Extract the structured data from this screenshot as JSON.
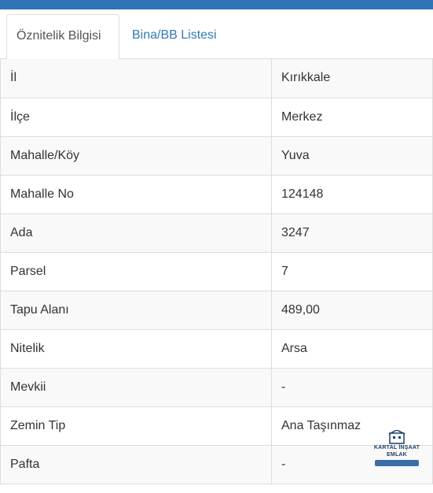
{
  "tabs": [
    {
      "label": "Öznitelik Bilgisi",
      "active": true
    },
    {
      "label": "Bina/BB Listesi",
      "active": false
    }
  ],
  "rows": [
    {
      "key": "İl",
      "value": "Kırıkkale"
    },
    {
      "key": "İlçe",
      "value": "Merkez"
    },
    {
      "key": "Mahalle/Köy",
      "value": "Yuva"
    },
    {
      "key": "Mahalle No",
      "value": "124148"
    },
    {
      "key": "Ada",
      "value": "3247"
    },
    {
      "key": "Parsel",
      "value": "7"
    },
    {
      "key": "Tapu Alanı",
      "value": "489,00"
    },
    {
      "key": "Nitelik",
      "value": "Arsa"
    },
    {
      "key": "Mevkii",
      "value": "-"
    },
    {
      "key": "Zemin Tip",
      "value": "Ana Taşınmaz"
    },
    {
      "key": "Pafta",
      "value": "-"
    }
  ],
  "logo": {
    "line1": "KARTAL İNŞAAT",
    "line2": "EMLAK"
  },
  "colors": {
    "header_bar": "#2f74b5",
    "link": "#337ab7",
    "border": "#dddddd",
    "stripe": "#f9f9f9"
  }
}
